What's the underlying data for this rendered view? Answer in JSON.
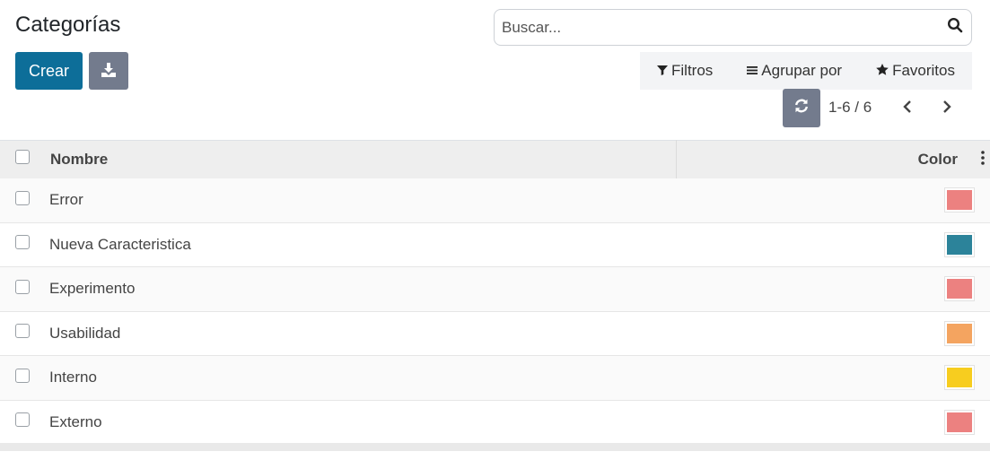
{
  "header": {
    "title": "Categorías",
    "create_label": "Crear"
  },
  "search": {
    "placeholder": "Buscar..."
  },
  "filters": {
    "filter_label": "Filtros",
    "group_label": "Agrupar por",
    "favorites_label": "Favoritos"
  },
  "pager": {
    "value": "1-6 / 6"
  },
  "table": {
    "columns": [
      "Nombre",
      "Color"
    ],
    "rows": [
      {
        "name": "Error",
        "color": "#ec8180"
      },
      {
        "name": "Nueva Caracteristica",
        "color": "#2c839a"
      },
      {
        "name": "Experimento",
        "color": "#ec8180"
      },
      {
        "name": "Usabilidad",
        "color": "#f4a460"
      },
      {
        "name": "Interno",
        "color": "#f7cd1f"
      },
      {
        "name": "Externo",
        "color": "#ec8180"
      }
    ]
  },
  "colors": {
    "primary": "#0d6e99",
    "secondary": "#737b8d"
  }
}
